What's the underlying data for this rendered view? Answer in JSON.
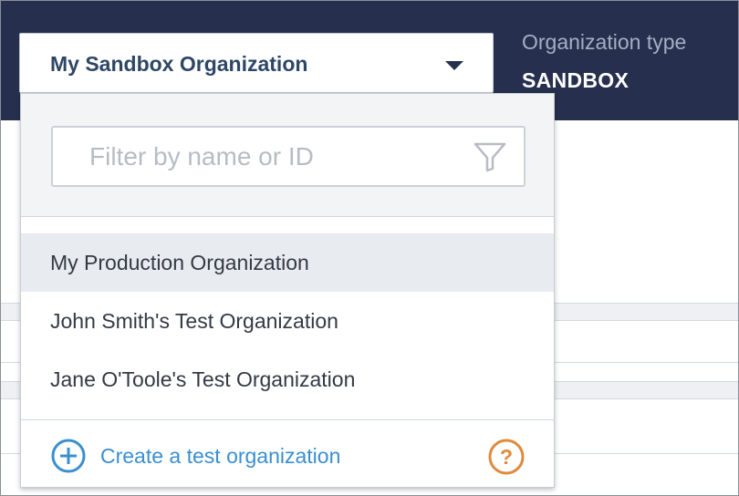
{
  "header": {
    "org_type_label": "Organization type",
    "org_type_value": "SANDBOX"
  },
  "selector": {
    "selected": "My Sandbox Organization",
    "icon": "chevron-down-icon"
  },
  "dropdown": {
    "filter": {
      "placeholder": "Filter by name or ID",
      "value": "",
      "icon": "filter-icon"
    },
    "items": [
      {
        "label": "My Production Organization",
        "highlighted": true
      },
      {
        "label": "John Smith's Test Organization",
        "highlighted": false
      },
      {
        "label": "Jane O'Toole's Test Organization",
        "highlighted": false
      }
    ],
    "footer": {
      "create_label": "Create a test organization",
      "create_icon": "plus-circle-icon",
      "help_icon": "help-icon"
    }
  },
  "colors": {
    "header_bg": "#26304e",
    "selected_text": "#2e4766",
    "link": "#3a8fd0",
    "help": "#e08a3c",
    "highlight_bg": "#e8ebef"
  }
}
